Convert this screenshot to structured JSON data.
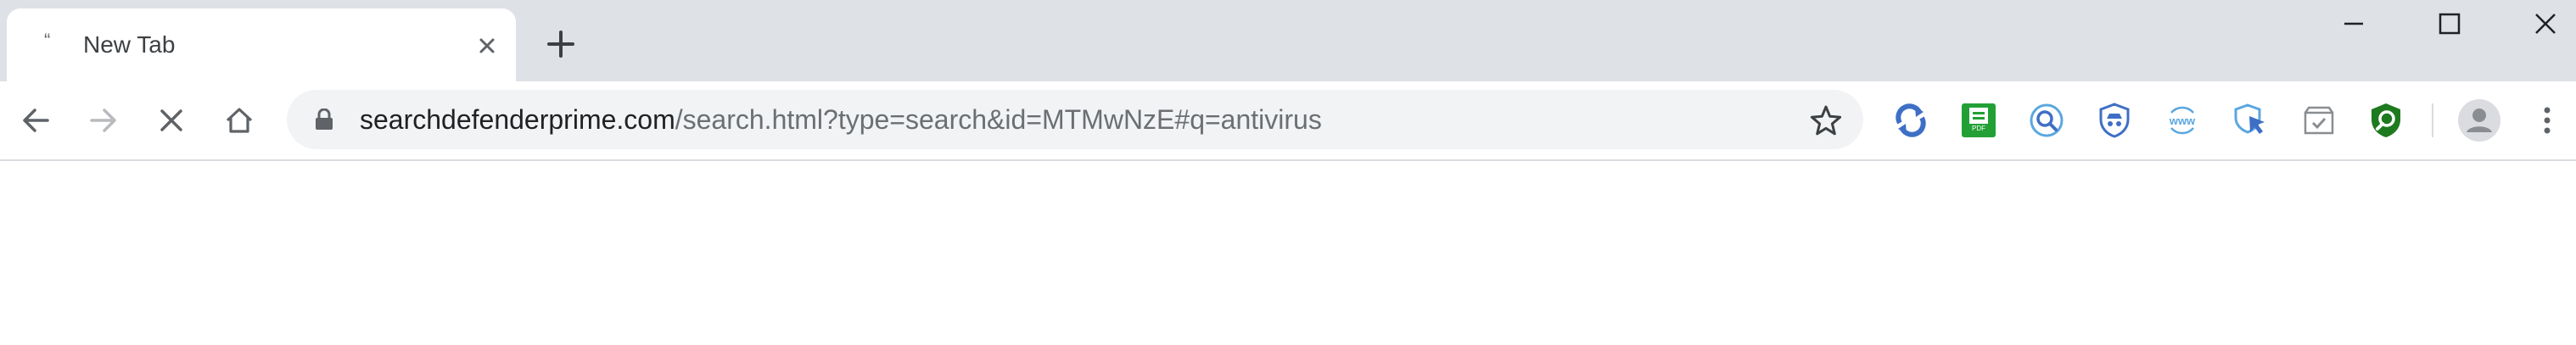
{
  "tab": {
    "title": "New Tab"
  },
  "address_bar": {
    "url_host": "searchdefenderprime.com",
    "url_path": "/search.html?type=search&id=MTMwNzE#q=antivirus"
  },
  "icons": {
    "back": "arrow-left-icon",
    "forward": "arrow-right-icon",
    "stop": "close-icon",
    "home": "home-icon",
    "lock": "lock-icon",
    "bookmark": "star-icon",
    "menu": "more-vertical-icon"
  },
  "extensions": [
    "refresh-sync-extension-icon",
    "pdf-document-extension-icon",
    "magnifier-search-extension-icon",
    "shield-incognito-extension-icon",
    "www-web-extension-icon",
    "cursor-shield-extension-icon",
    "package-check-extension-icon",
    "green-shield-search-extension-icon"
  ],
  "colors": {
    "tab_strip": "#dee1e6",
    "omnibox": "#f1f3f4",
    "url_host": "#202124",
    "url_path": "#6b6f73",
    "icon": "#5f6368",
    "ext_blue": "#3f6fc5",
    "ext_light_blue": "#5aa7e0",
    "ext_green": "#22a035",
    "ext_dark_green": "#1e7a1e"
  }
}
